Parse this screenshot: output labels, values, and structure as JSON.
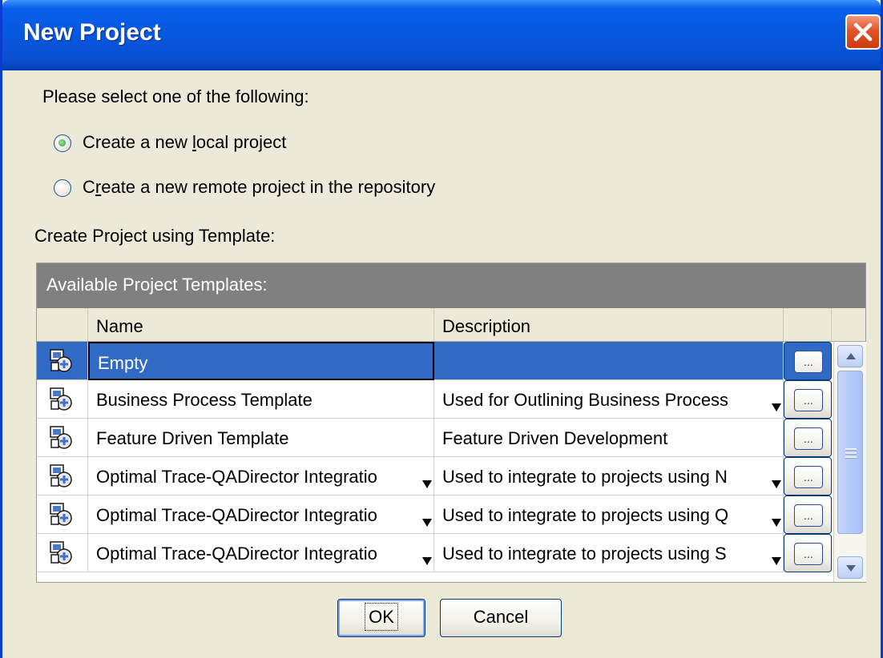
{
  "window": {
    "title": "New Project"
  },
  "prompt": "Please select one of the following:",
  "options": [
    {
      "label_pre": "Create a new ",
      "label_u": "l",
      "label_post": "ocal project",
      "checked": true
    },
    {
      "label_pre": "C",
      "label_u": "r",
      "label_post": "eate a new remote project in the repository",
      "checked": false
    }
  ],
  "template_label": "Create Project using Template:",
  "grid": {
    "caption": "Available Project Templates:",
    "columns": {
      "name": "Name",
      "description": "Description"
    },
    "rows": [
      {
        "name": "Empty",
        "description": "",
        "selected": true,
        "name_truncated": false,
        "desc_truncated": false
      },
      {
        "name": "Business Process Template",
        "description": "Used for Outlining Business Process",
        "selected": false,
        "name_truncated": false,
        "desc_truncated": true
      },
      {
        "name": "Feature Driven Template",
        "description": "Feature Driven Development",
        "selected": false,
        "name_truncated": false,
        "desc_truncated": false
      },
      {
        "name": "Optimal Trace-QADirector Integratio",
        "description": "Used to integrate to projects using N",
        "selected": false,
        "name_truncated": true,
        "desc_truncated": true
      },
      {
        "name": "Optimal Trace-QADirector Integratio",
        "description": "Used to integrate to projects using Q",
        "selected": false,
        "name_truncated": true,
        "desc_truncated": true
      },
      {
        "name": "Optimal Trace-QADirector Integratio",
        "description": "Used to integrate to projects using S",
        "selected": false,
        "name_truncated": true,
        "desc_truncated": true
      }
    ],
    "ellipsis": "..."
  },
  "buttons": {
    "ok": "OK",
    "cancel": "Cancel"
  },
  "icons": {
    "close": "close-icon",
    "template": "template-icon",
    "radio": "radio-icon"
  },
  "colors": {
    "titlebar": "#0757e0",
    "selection": "#316ac5",
    "caption": "#808080",
    "background": "#ece9d8"
  }
}
